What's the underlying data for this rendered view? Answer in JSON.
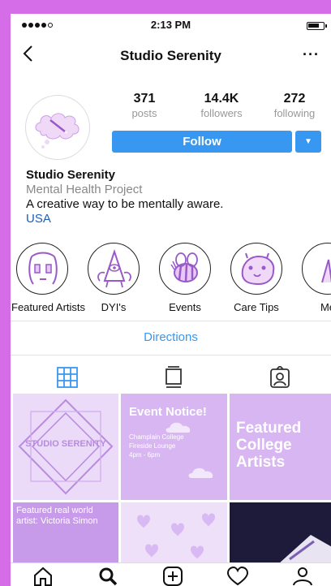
{
  "status": {
    "time": "2:13 PM"
  },
  "nav": {
    "title": "Studio Serenity",
    "back_icon": "chevron-left-icon",
    "more_label": "···"
  },
  "stats": [
    {
      "value": "371",
      "label": "posts"
    },
    {
      "value": "14.4K",
      "label": "followers"
    },
    {
      "value": "272",
      "label": "following"
    }
  ],
  "follow": {
    "label": "Follow",
    "dropdown_glyph": "▼"
  },
  "bio": {
    "name": "Studio Serenity",
    "category": "Mental Health Project",
    "description": "A creative way to be mentally aware.",
    "location": "USA"
  },
  "highlights": [
    {
      "label": "Featured Artists",
      "icon": "face-drawing-icon"
    },
    {
      "label": "DYI's",
      "icon": "pyramid-eye-icon"
    },
    {
      "label": "Events",
      "icon": "bee-icon"
    },
    {
      "label": "Care Tips",
      "icon": "capybara-icon"
    },
    {
      "label": "Me",
      "icon": "partial-highlight-icon"
    }
  ],
  "directions_label": "Directions",
  "posts": [
    {
      "text": "STUDIO SERENITY"
    },
    {
      "title": "Event Notice!",
      "lines": [
        "Champlain College",
        "Fireside Lounge",
        "4pm - 6pm"
      ]
    },
    {
      "lines": [
        "Featured",
        "College",
        "Artists"
      ]
    },
    {
      "lines": [
        "Featured real world",
        "artist: Victoria Simon"
      ]
    },
    {},
    {}
  ],
  "colors": {
    "accent": "#3897f0",
    "brand": "#d56ce8",
    "tile_purple": "#d7b6f2"
  }
}
